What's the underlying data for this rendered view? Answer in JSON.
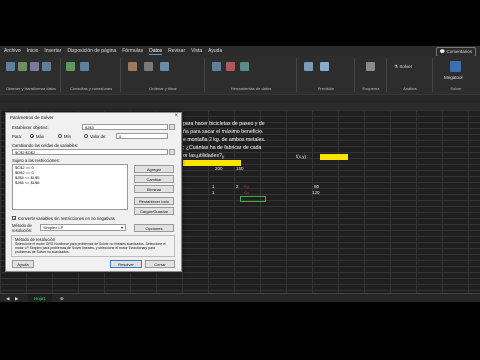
{
  "ribbon_menu": {
    "items": [
      "Archivo",
      "Inicio",
      "Insertar",
      "Disposición de página",
      "Fórmulas",
      "Datos",
      "Revisar",
      "Vista",
      "Ayuda"
    ],
    "active": "Datos",
    "comments_button": "Comentarios"
  },
  "ribbon": {
    "group1_label": "Obtener y transformar datos",
    "group2_label": "Consultas y conexiones",
    "group3_label": "Ordenar y filtrar",
    "group4_label": "Herramientas de datos",
    "group5_label": "Previsión",
    "group6_label": "Esquema",
    "group7_label": "Análisis",
    "group8_label": "Solver",
    "solver_label": "Solver",
    "ia_label": "Megatool"
  },
  "sheet": {
    "problem_lines": [
      "para hacer bicicletas de paseo y de",
      "ña para sacar el máximo beneficio.",
      "e montaña 2 kg. de ambos metales.",
      "; ¿Cuántas ha de fabricar de cada",
      "or las utilidades?"
    ],
    "cells": {
      "x_label": "x",
      "y_label": "y",
      "v200": "200",
      "v150": "150",
      "obj_label": "f(x,y) :",
      "one_a": "1",
      "one_b": "1",
      "two_a": "2",
      "lt_a": "<=",
      "lt_b": "<=",
      "v80": "80",
      "v120": "120"
    },
    "tab_name": "Hoja1"
  },
  "dialog": {
    "title": "Parámetros de Solver",
    "objective_label": "Establecer objetivo:",
    "objective_value": "$J$3",
    "para_label": "Para:",
    "opt_max": "Máx",
    "opt_min": "Mín",
    "opt_value": "Valor de:",
    "value_field": "0",
    "change_label": "Cambiando las celdas de variables:",
    "change_value": "$C$2:$D$2",
    "constraints_label": "Sujeto a las restricciones:",
    "constraints": [
      "$C$2 >= 0",
      "$D$2 >= 0",
      "$J$5 <= $L$5",
      "$J$6 <= $L$6"
    ],
    "btn_add": "Agregar",
    "btn_change": "Cambiar",
    "btn_delete": "Eliminar",
    "btn_reset": "Restablecer todo",
    "btn_load": "Cargar/Guardar",
    "nonneg_label": "Convertir variables sin restricciones en no negativas",
    "method_label": "Método de resolución:",
    "method_value": "Simplex LP",
    "btn_options": "Opciones",
    "method_group_title": "Método de resolución",
    "method_desc": "Seleccione el motor GRG Nonlinear para problemas de Solver no lineales suavizados. Seleccione el motor LP Simplex para problemas de Solver lineales, y seleccione el motor Evolutionary para problemas de Solver no suavizados.",
    "btn_help": "Ayuda",
    "btn_solve": "Resolver",
    "btn_close": "Cerrar"
  },
  "colors": {
    "accent": "#4aa3df",
    "highlight": "#ffe300",
    "tab_active": "#4fd14f"
  }
}
